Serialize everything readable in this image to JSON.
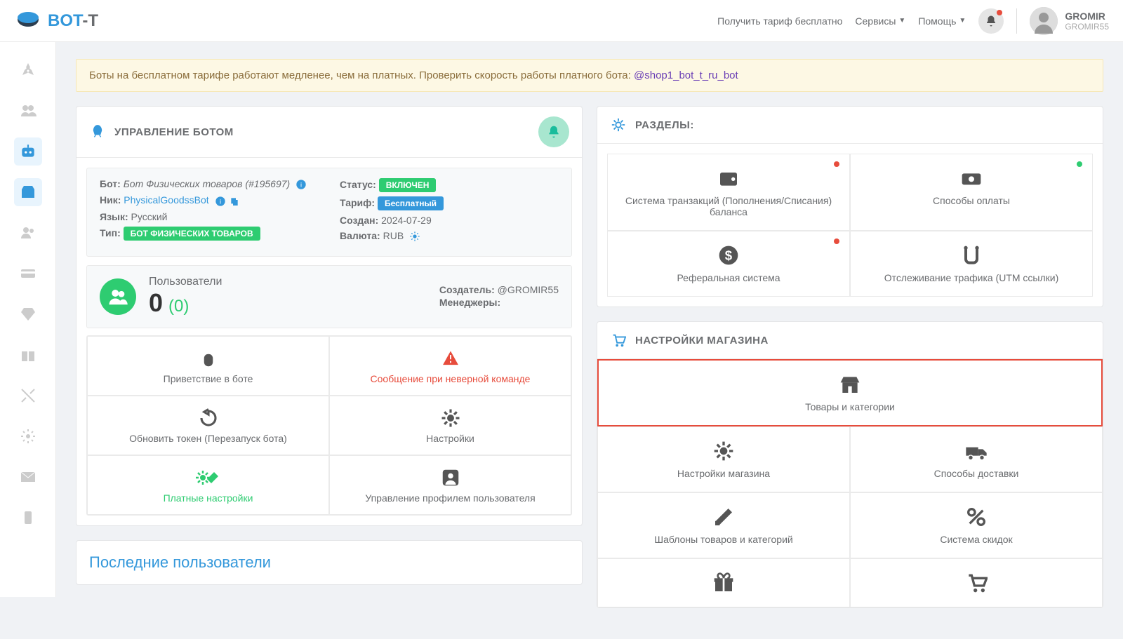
{
  "header": {
    "free_tariff": "Получить тариф бесплатно",
    "services": "Сервисы",
    "help": "Помощь",
    "user_name": "GROMIR",
    "user_handle": "GROMIR55"
  },
  "alert": {
    "text": "Боты на бесплатном тарифе работают медленее, чем на платных. Проверить скорость работы платного бота: ",
    "link": "@shop1_bot_t_ru_bot"
  },
  "bot_panel": {
    "title": "УПРАВЛЕНИЕ БОТОМ",
    "bot_label": "Бот:",
    "bot_value": "Бот Физических товаров (#195697)",
    "nick_label": "Ник:",
    "nick_value": "PhysicalGoodssBot",
    "lang_label": "Язык:",
    "lang_value": "Русский",
    "type_label": "Тип:",
    "type_value": "БОТ ФИЗИЧЕСКИХ ТОВАРОВ",
    "status_label": "Статус:",
    "status_value": "ВКЛЮЧЕН",
    "tariff_label": "Тариф:",
    "tariff_value": "Бесплатный",
    "created_label": "Создан:",
    "created_value": "2024-07-29",
    "currency_label": "Валюта:",
    "currency_value": "RUB",
    "users_label": "Пользователи",
    "users_count": "0",
    "users_sub": "(0)",
    "creator_label": "Создатель:",
    "creator_value": "@GROMIR55",
    "managers_label": "Менеджеры:"
  },
  "tiles": {
    "greeting": "Приветствие в боте",
    "wrong_cmd": "Сообщение при неверной команде",
    "refresh": "Обновить токен (Перезапуск бота)",
    "settings": "Настройки",
    "paid_settings": "Платные настройки",
    "profile": "Управление профилем пользователя"
  },
  "sections_panel": {
    "title": "РАЗДЕЛЫ:",
    "tiles": {
      "transactions": "Система транзакций (Пополнения/Списания) баланса",
      "payments": "Способы оплаты",
      "referral": "Реферальная система",
      "tracking": "Отслеживание трафика (UTM ссылки)"
    }
  },
  "shop_panel": {
    "title": "НАСТРОЙКИ МАГАЗИНА",
    "tiles": {
      "goods": "Товары и категории",
      "shop_settings": "Настройки магазина",
      "delivery": "Способы доставки",
      "templates": "Шаблоны товаров и категорий",
      "discounts": "Система скидок"
    }
  },
  "last_users": {
    "title": "Последние пользователи"
  }
}
